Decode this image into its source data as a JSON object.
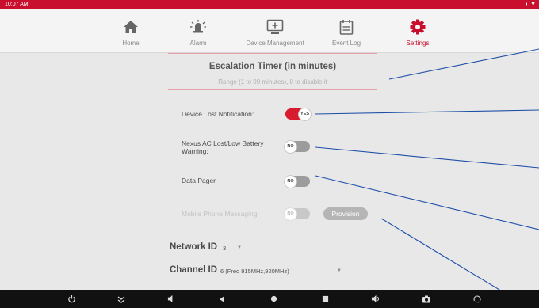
{
  "status_bar": {
    "time": "10:07 AM"
  },
  "nav": {
    "items": [
      {
        "label": "Home",
        "icon": "home-icon",
        "active": false
      },
      {
        "label": "Alarm",
        "icon": "alarm-icon",
        "active": false
      },
      {
        "label": "Device Management",
        "icon": "device-management-icon",
        "active": false
      },
      {
        "label": "Event Log",
        "icon": "event-log-icon",
        "active": false
      },
      {
        "label": "Settings",
        "icon": "gear-icon",
        "active": true
      }
    ]
  },
  "escalation": {
    "title": "Escalation Timer (in minutes)",
    "range_hint": "Range (1 to 99 minutes), 0 to disable it"
  },
  "settings": {
    "device_lost": {
      "label": "Device Lost Notification:",
      "state": "YES"
    },
    "nexus_ac": {
      "label_line1": "Nexus AC Lost/Low Battery",
      "label_line2": "Warning:",
      "state": "NO"
    },
    "data_pager": {
      "label": "Data Pager",
      "state": "NO"
    },
    "mobile_phone": {
      "label": "Mobile Phone Messaging:",
      "state": "NO"
    },
    "provision_label": "Provision"
  },
  "network": {
    "label": "Network ID",
    "value": "3"
  },
  "channel": {
    "label": "Channel ID",
    "value": "6 (Freq 915MHz,920MHz)"
  },
  "colors": {
    "accent": "#c8102e",
    "toggle_on": "#d81b2e",
    "annotation_line": "#1f4fa8"
  }
}
